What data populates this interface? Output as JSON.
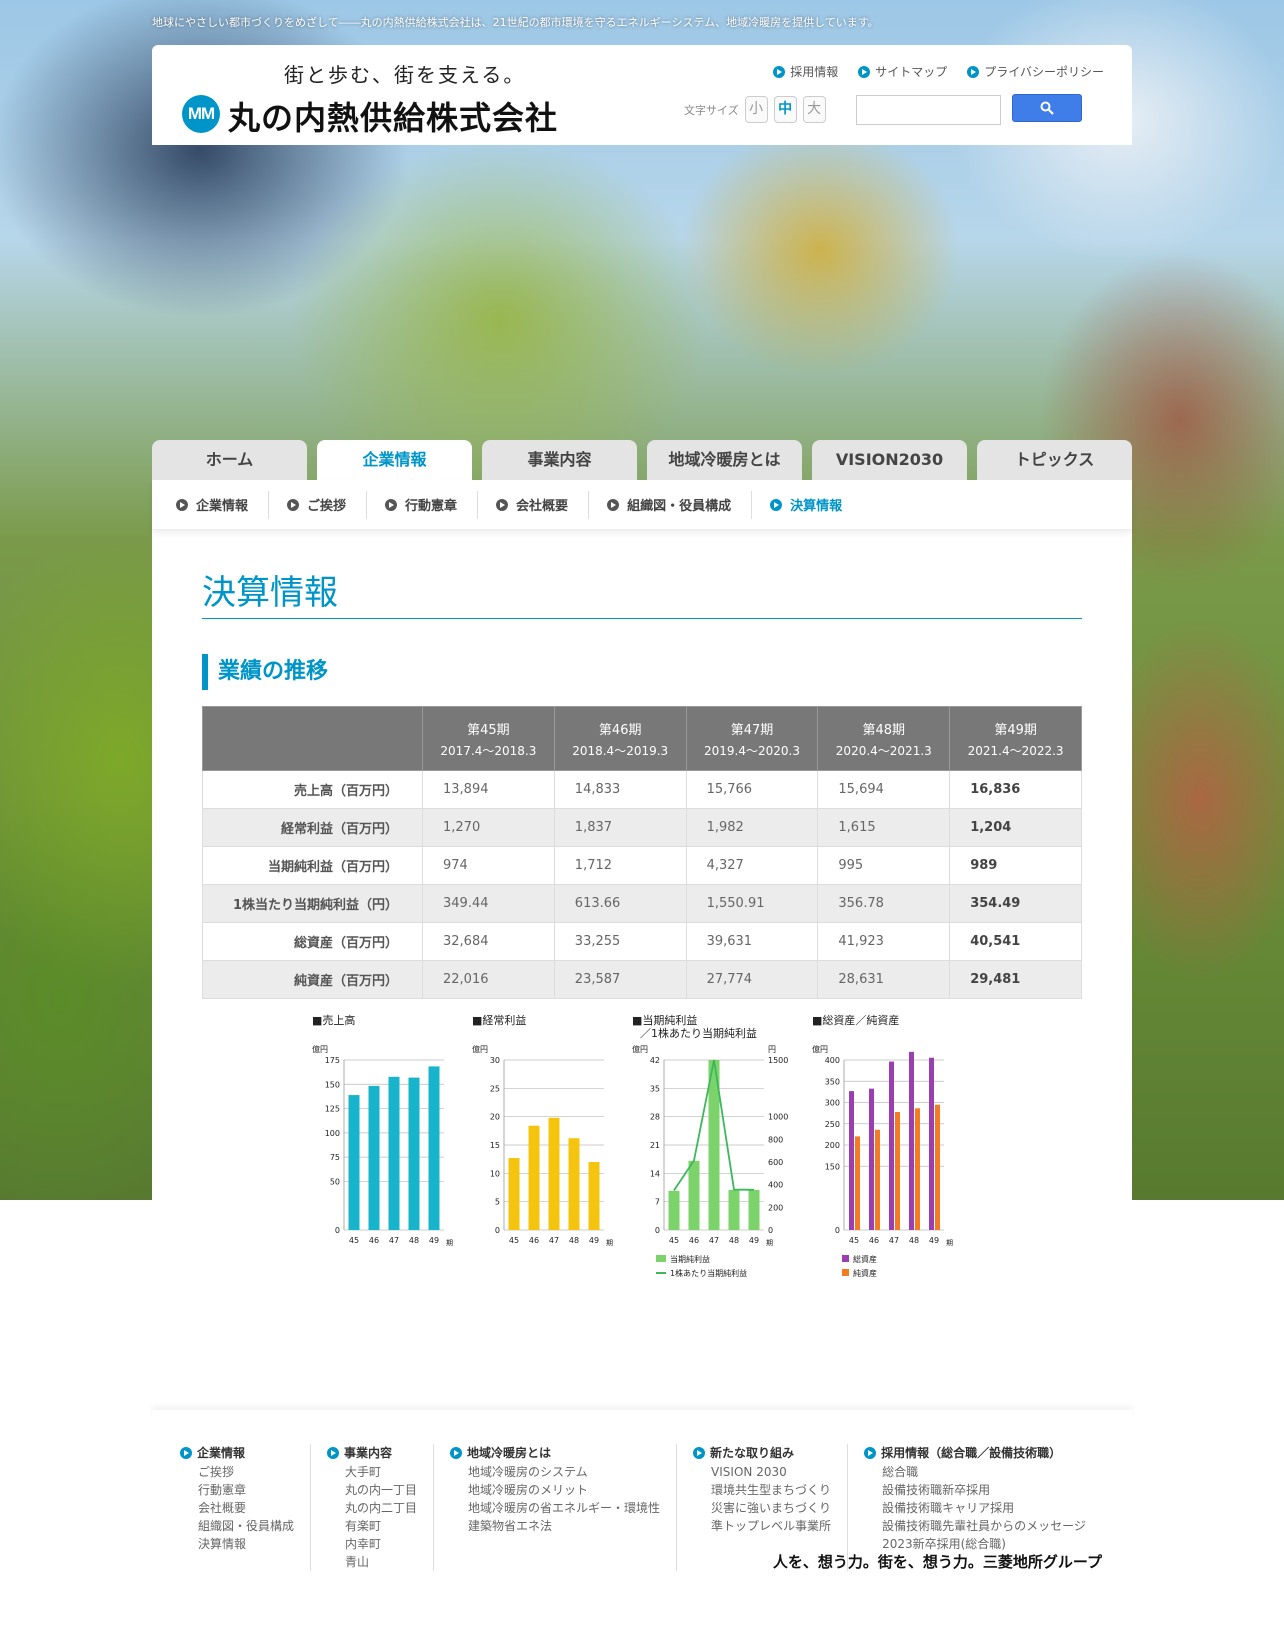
{
  "tagline": "地球にやさしい都市づくりをめざして――丸の内熱供給株式会社は、21世紀の都市環境を守るエネルギーシステム、地域冷暖房を提供しています。",
  "header": {
    "catch": "街と歩む、街を支える。",
    "logo_text": "丸の内熱供給株式会社",
    "logo_mark": "MM",
    "util_links": [
      "採用情報",
      "サイトマップ",
      "プライバシーポリシー"
    ],
    "font_size_label": "文字サイズ",
    "font_sizes": [
      "小",
      "中",
      "大"
    ],
    "search_placeholder": ""
  },
  "nav_tabs": [
    "ホーム",
    "企業情報",
    "事業内容",
    "地域冷暖房とは",
    "VISION2030",
    "トピックス"
  ],
  "subnav": [
    "企業情報",
    "ご挨拶",
    "行動憲章",
    "会社概要",
    "組織図・役員構成",
    "決算情報"
  ],
  "page_title": "決算情報",
  "section_title": "業績の推移",
  "table": {
    "periods": [
      {
        "name": "第45期",
        "range": "2017.4～2018.3"
      },
      {
        "name": "第46期",
        "range": "2018.4～2019.3"
      },
      {
        "name": "第47期",
        "range": "2019.4～2020.3"
      },
      {
        "name": "第48期",
        "range": "2020.4～2021.3"
      },
      {
        "name": "第49期",
        "range": "2021.4～2022.3"
      }
    ],
    "rows": [
      {
        "label": "売上高（百万円）",
        "values": [
          "13,894",
          "14,833",
          "15,766",
          "15,694",
          "16,836"
        ]
      },
      {
        "label": "経常利益（百万円）",
        "values": [
          "1,270",
          "1,837",
          "1,982",
          "1,615",
          "1,204"
        ]
      },
      {
        "label": "当期純利益（百万円）",
        "values": [
          "974",
          "1,712",
          "4,327",
          "995",
          "989"
        ]
      },
      {
        "label": "1株当たり当期純利益（円）",
        "values": [
          "349.44",
          "613.66",
          "1,550.91",
          "356.78",
          "354.49"
        ]
      },
      {
        "label": "総資産（百万円）",
        "values": [
          "32,684",
          "33,255",
          "39,631",
          "41,923",
          "40,541"
        ]
      },
      {
        "label": "純資産（百万円）",
        "values": [
          "22,016",
          "23,587",
          "27,774",
          "28,631",
          "29,481"
        ]
      }
    ]
  },
  "chart_data": [
    {
      "type": "bar",
      "title": "■売上高",
      "ylabel": "億円",
      "xlabel": "期",
      "categories": [
        "45",
        "46",
        "47",
        "48",
        "49"
      ],
      "values": [
        138.9,
        148.3,
        157.7,
        156.9,
        168.4
      ],
      "ylim": [
        0,
        175
      ],
      "yticks": [
        0,
        50,
        75,
        100,
        125,
        150,
        175
      ],
      "color": "#18b4cc"
    },
    {
      "type": "bar",
      "title": "■経常利益",
      "ylabel": "億円",
      "xlabel": "期",
      "categories": [
        "45",
        "46",
        "47",
        "48",
        "49"
      ],
      "values": [
        12.7,
        18.4,
        19.8,
        16.2,
        12.0
      ],
      "ylim": [
        0,
        30
      ],
      "yticks": [
        0,
        5,
        10,
        15,
        20,
        25,
        30
      ],
      "color": "#f5c40f"
    },
    {
      "type": "bar+line",
      "title": "■当期純利益",
      "title2": "／1株あたり当期純利益",
      "ylabel": "億円",
      "ylabel2": "円",
      "xlabel": "期",
      "categories": [
        "45",
        "46",
        "47",
        "48",
        "49"
      ],
      "series": [
        {
          "name": "当期純利益",
          "values": [
            9.7,
            17.1,
            43.3,
            9.9,
            9.9
          ],
          "color": "#7dd36b"
        },
        {
          "name": "1株あたり当期純利益",
          "values": [
            349.44,
            613.66,
            1550.91,
            356.78,
            354.49
          ],
          "color": "#3cb85c"
        }
      ],
      "ylim": [
        0,
        42
      ],
      "yticks": [
        0,
        7,
        14,
        21,
        28,
        35,
        42
      ],
      "ylim2": [
        0,
        1500
      ],
      "yticks2": [
        0,
        200,
        400,
        600,
        800,
        1000,
        1500
      ]
    },
    {
      "type": "bar",
      "title": "■総資産／純資産",
      "ylabel": "億円",
      "xlabel": "期",
      "categories": [
        "45",
        "46",
        "47",
        "48",
        "49"
      ],
      "series": [
        {
          "name": "総資産",
          "values": [
            326.8,
            332.6,
            396.3,
            419.2,
            405.4
          ],
          "color": "#9b3fb0"
        },
        {
          "name": "純資産",
          "values": [
            220.2,
            235.9,
            277.7,
            286.3,
            294.8
          ],
          "color": "#f57a22"
        }
      ],
      "ylim": [
        0,
        400
      ],
      "yticks": [
        0,
        150,
        200,
        250,
        300,
        350,
        400
      ]
    }
  ],
  "footer": {
    "columns": [
      {
        "head": "企業情報",
        "items": [
          "ご挨拶",
          "行動憲章",
          "会社概要",
          "組織図・役員構成",
          "決算情報"
        ]
      },
      {
        "head": "事業内容",
        "items": [
          "大手町",
          "丸の内一丁目",
          "丸の内二丁目",
          "有楽町",
          "内幸町",
          "青山"
        ]
      },
      {
        "head": "地域冷暖房とは",
        "items": [
          "地域冷暖房のシステム",
          "地域冷暖房のメリット",
          "地域冷暖房の省エネルギー・環境性",
          "建築物省エネ法"
        ]
      },
      {
        "head": "新たな取り組み",
        "items": [
          "VISION 2030",
          "環境共生型まちづくり",
          "災害に強いまちづくり",
          "準トップレベル事業所"
        ]
      },
      {
        "head": "採用情報（総合職／設備技術職）",
        "items": [
          "総合職",
          "設備技術職新卒採用",
          "設備技術職キャリア採用",
          "設備技術職先輩社員からのメッセージ",
          "2023新卒採用(総合職)"
        ]
      }
    ],
    "group_logo": "人を、想う力。街を、想う力。三菱地所グループ"
  }
}
